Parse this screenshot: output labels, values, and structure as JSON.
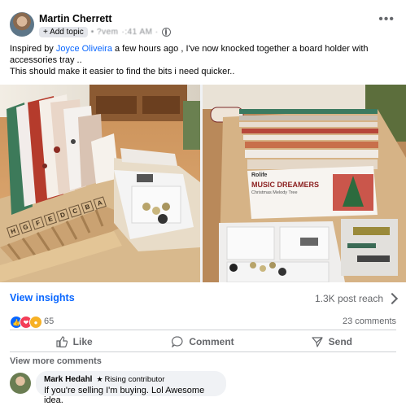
{
  "post": {
    "author": "Martin Cherrett",
    "add_topic": "+ Add topic",
    "timestamp_partial": "• ?vem",
    "timestamp_partial2": "·:41 AM ·",
    "body_prefix": "Inspired by ",
    "mention": "Joyce Oliveira",
    "body_suffix": " a few hours ago , I've now knocked together a board holder with accessories tray ..",
    "body_line2": "This should make it easier to find the bits i need quicker..",
    "more_label": "•••"
  },
  "photos": {
    "left_letters": [
      "H",
      "G",
      "F",
      "E",
      "D",
      "C",
      "B",
      "A"
    ],
    "right_box_brand": "Rolife",
    "right_box_title": "MUSIC DREAMERS",
    "right_box_sub": "Christmas Melody Tree"
  },
  "insights": {
    "view_label": "View insights",
    "reach_label": "1.3K post reach"
  },
  "reactions": {
    "count": "65",
    "comments": "23 comments"
  },
  "actions": {
    "like": "Like",
    "comment": "Comment",
    "send": "Send"
  },
  "comments": {
    "view_more": "View more comments",
    "items": [
      {
        "name": "Mark Hedahl",
        "badge": "Rising contributor",
        "text": "If you're selling I'm buying. Lol Awesome idea."
      }
    ]
  },
  "colors": {
    "accent": "#0866ff",
    "secondary_text": "#65676b"
  }
}
